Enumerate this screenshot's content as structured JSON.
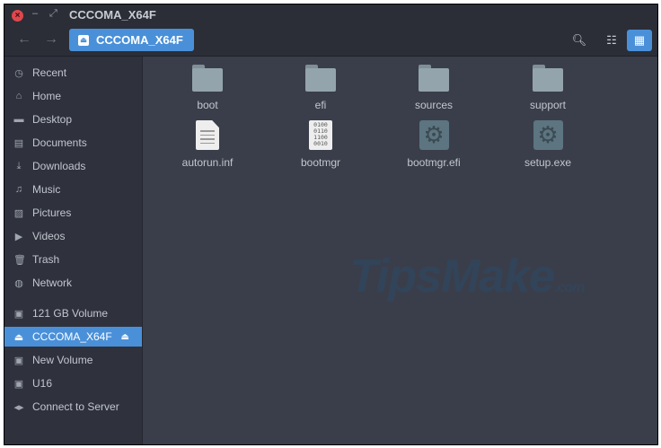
{
  "window": {
    "title": "CCCOMA_X64F"
  },
  "toolbar": {
    "path_label": "CCCOMA_X64F",
    "back": "←",
    "forward": "→"
  },
  "sidebar": {
    "items": [
      {
        "label": "Recent",
        "icon": "◷"
      },
      {
        "label": "Home",
        "icon": "⌂"
      },
      {
        "label": "Desktop",
        "icon": "▬"
      },
      {
        "label": "Documents",
        "icon": "▤"
      },
      {
        "label": "Downloads",
        "icon": "⤓"
      },
      {
        "label": "Music",
        "icon": "♫"
      },
      {
        "label": "Pictures",
        "icon": "▨"
      },
      {
        "label": "Videos",
        "icon": "▶"
      },
      {
        "label": "Trash",
        "icon": "🗑"
      },
      {
        "label": "Network",
        "icon": "◍"
      }
    ],
    "devices": [
      {
        "label": "121 GB Volume",
        "icon": "▣"
      },
      {
        "label": "CCCOMA_X64F",
        "icon": "⏏"
      },
      {
        "label": "New Volume",
        "icon": "▣"
      },
      {
        "label": "U16",
        "icon": "▣"
      },
      {
        "label": "Connect to Server",
        "icon": "◂▸"
      }
    ]
  },
  "files": [
    {
      "name": "boot",
      "type": "folder"
    },
    {
      "name": "efi",
      "type": "folder"
    },
    {
      "name": "sources",
      "type": "folder"
    },
    {
      "name": "support",
      "type": "folder"
    },
    {
      "name": "autorun.inf",
      "type": "text"
    },
    {
      "name": "bootmgr",
      "type": "binary",
      "glyph": "0100\n0110\n1100\n0010"
    },
    {
      "name": "bootmgr.efi",
      "type": "exe"
    },
    {
      "name": "setup.exe",
      "type": "exe"
    }
  ],
  "watermark": {
    "text": "TipsMake",
    "suffix": ".com"
  }
}
